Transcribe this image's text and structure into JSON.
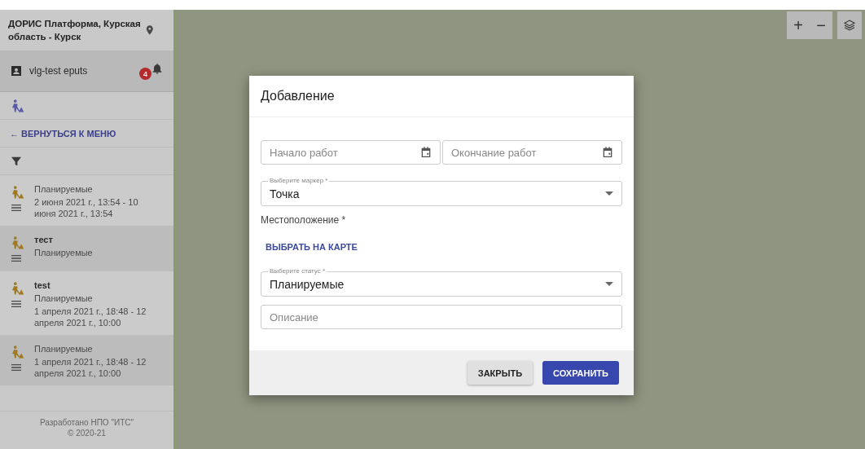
{
  "sidebar": {
    "title": "ДОРИС Платформа, Курская область - Курск",
    "user": {
      "name": "vlg-test eputs",
      "notifications": "4"
    },
    "back_link": "← ВЕРНУТЬСЯ К МЕНЮ",
    "items": [
      {
        "lines": [
          "Планируемые",
          "2 июня 2021 г., 13:54 - 10 июня 2021 г., 13:54"
        ],
        "selected": false
      },
      {
        "title": "тест",
        "lines": [
          "Планируемые"
        ],
        "selected": true
      },
      {
        "title": "test",
        "lines": [
          "Планируемые",
          "1 апреля 2021 г., 18:48 - 12 апреля 2021 г., 10:00"
        ],
        "selected": false
      },
      {
        "lines": [
          "Планируемые",
          "1 апреля 2021 г., 18:48 - 12 апреля 2021 г., 10:00"
        ],
        "selected": true
      }
    ],
    "footer": [
      "Разработано НПО \"ИТС\"",
      "© 2020-21"
    ]
  },
  "map_controls": {
    "zoom_in": "+",
    "zoom_out": "−"
  },
  "dialog": {
    "title": "Добавление",
    "start_field": {
      "placeholder": "Начало работ"
    },
    "end_field": {
      "placeholder": "Окончание работ"
    },
    "marker_select": {
      "label": "Выберите маркер *",
      "value": "Точка"
    },
    "location_label": "Местоположение *",
    "pick_on_map": "ВЫБРАТЬ НА КАРТЕ",
    "status_select": {
      "label": "Выберите статус *",
      "value": "Планируемые"
    },
    "description_field": {
      "placeholder": "Описание"
    },
    "buttons": {
      "close": "ЗАКРЫТЬ",
      "save": "СОХРАНИТЬ"
    }
  }
}
